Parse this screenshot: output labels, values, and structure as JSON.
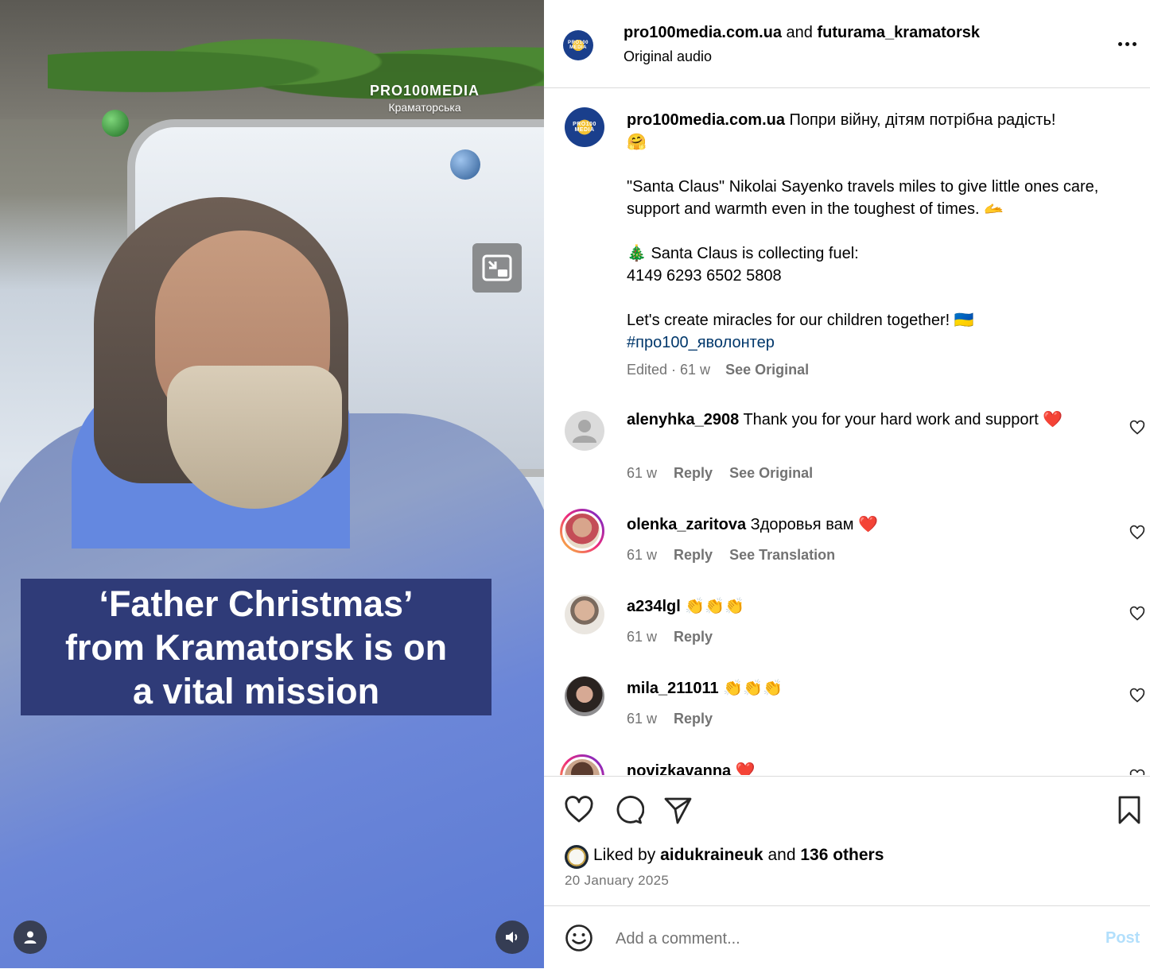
{
  "video": {
    "watermark_title": "PRO100MEDIA",
    "watermark_subtitle": "Краматорська",
    "caption": "‘Father Christmas’\nfrom Kramatorsk is on\na vital mission"
  },
  "header": {
    "owner": "pro100media.com.ua",
    "joiner": "and",
    "collaborator": "futurama_kramatorsk",
    "audio": "Original audio",
    "avatar_text": "PRO100 MEDIA"
  },
  "post": {
    "username": "pro100media.com.ua",
    "lines": [
      "Попри війну, дітям потрібна радість!",
      "🤗",
      "\"Santa Claus\" Nikolai Sayenko travels miles to give little ones care, support and warmth even in the toughest of times. 🫴",
      "🎄 Santa Claus is collecting fuel:",
      "4149 6293 6502 5808",
      "Let's create miracles for our children together! 🇺🇦"
    ],
    "hashtag": "#про100_яволонтер",
    "edited": "Edited · 61 w",
    "see_original": "See Original"
  },
  "comments": [
    {
      "user": "alenyhka_2908",
      "text": "Thank you for your hard work and support ❤️",
      "age": "61 w",
      "reply": "Reply",
      "extra": "See Original"
    },
    {
      "user": "olenka_zaritova",
      "text": "Здоровья вам ❤️",
      "age": "61 w",
      "reply": "Reply",
      "extra": "See Translation"
    },
    {
      "user": "a234lgl",
      "text": "👏👏👏",
      "age": "61 w",
      "reply": "Reply"
    },
    {
      "user": "mila_211011",
      "text": "👏👏👏",
      "age": "61 w",
      "reply": "Reply"
    },
    {
      "user": "novizkavanna",
      "text": "❤️"
    }
  ],
  "likes": {
    "prefix": "Liked by",
    "user": "aidukraineuk",
    "joiner": "and",
    "others": "136 others"
  },
  "date": "20 January 2025",
  "composer": {
    "placeholder": "Add a comment...",
    "post_label": "Post"
  },
  "colors": {
    "caption_bg": "#2f3b78",
    "link": "#00376b",
    "muted": "#737373",
    "post_disabled": "#b2dffc"
  },
  "icons": [
    "pip-icon",
    "user-icon",
    "volume-icon",
    "more-icon",
    "heart-icon",
    "comment-icon",
    "share-icon",
    "bookmark-icon",
    "emoji-icon"
  ]
}
